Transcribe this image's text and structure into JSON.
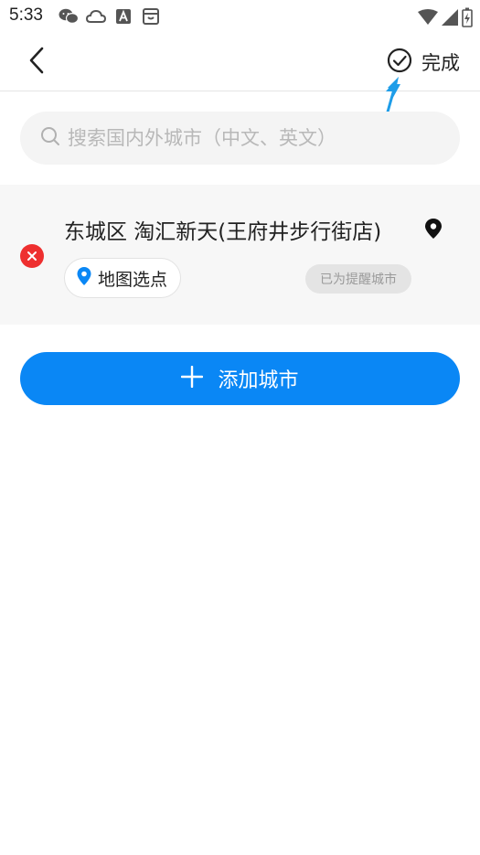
{
  "status_bar": {
    "time": "5:33",
    "left_icons": [
      "wechat-icon",
      "cloud-icon",
      "app-a-icon",
      "bag-icon"
    ],
    "right_icons": [
      "wifi-icon",
      "signal-icon",
      "battery-charging-icon"
    ]
  },
  "nav": {
    "back_icon": "chevron-left-icon",
    "done_icon": "check-circle-icon",
    "done_label": "完成"
  },
  "search": {
    "placeholder": "搜索国内外城市（中文、英文）",
    "value": ""
  },
  "cities": [
    {
      "name": "东城区 淘汇新天(王府井步行街店)",
      "map_pick_label": "地图选点",
      "badge": "已为提醒城市"
    }
  ],
  "add_city_label": "添加城市",
  "colors": {
    "accent": "#0a87f5",
    "remove": "#ee2f2f",
    "annotation": "#1e9de8"
  }
}
